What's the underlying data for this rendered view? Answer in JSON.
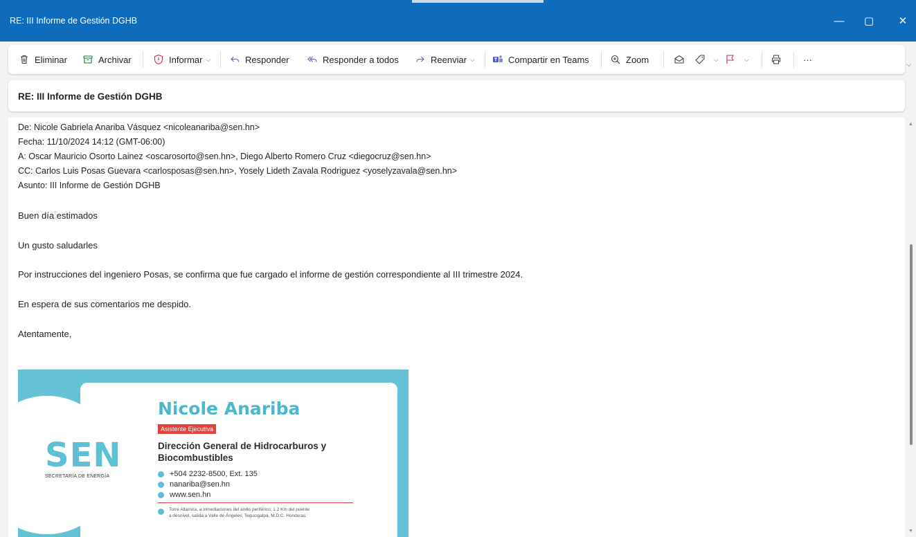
{
  "window": {
    "title": "RE: III Informe de Gestión DGHB",
    "minimize": "—",
    "maximize": "▢",
    "close": "✕"
  },
  "toolbar": {
    "delete": "Eliminar",
    "archive": "Archivar",
    "report": "Informar",
    "reply": "Responder",
    "reply_all": "Responder a todos",
    "forward": "Reenviar",
    "share_teams": "Compartir en Teams",
    "zoom": "Zoom",
    "more": "···"
  },
  "message": {
    "subject": "RE: III Informe de Gestión DGHB",
    "quoted_header": {
      "from": "De: Nicole Gabriela Anariba Vásquez <nicoleanariba@sen.hn>",
      "date": "Fecha: 11/10/2024 14:12 (GMT-06:00)",
      "to": "A: Oscar Mauricio Osorto Lainez <oscarosorto@sen.hn>, Diego Alberto Romero Cruz <diegocruz@sen.hn>",
      "cc": "CC: Carlos Luis Posas Guevara <carlosposas@sen.hn>, Yosely Lideth Zavala Rodriguez <yoselyzavala@sen.hn>",
      "subject": "Asunto: III Informe de Gestión DGHB"
    },
    "body": [
      "Buen día estimados",
      "Un gusto saludarles",
      "Por instrucciones del ingeniero Posas, se confirma que fue cargado el informe de gestión correspondiente al III trimestre 2024.",
      "En espera de sus comentarios me despido.",
      "Atentamente,"
    ]
  },
  "signature": {
    "logo": "SEN",
    "logo_sub": "SECRETARÍA DE ENERGÍA",
    "name": "Nicole Anariba",
    "role": "Asistente Ejecutiva",
    "org_line1": "Dirección General de Hidrocarburos y",
    "org_line2": "Biocombustibles",
    "phone": "+504 2232-8500, Ext. 135",
    "email": "nanariba@sen.hn",
    "web": "www.sen.hn",
    "address_line1": "Torre Altamira, a inmediaciones del anillo periférico; 1.2 Km del puente",
    "address_line2": "a desnivel, salida a Valle de Ángeles, Tegucigalpa, M.D.C. Honduras."
  },
  "colors": {
    "titlebar": "#0f6cbd",
    "signature_teal": "#65c2d6",
    "signature_red": "#e6403a"
  }
}
